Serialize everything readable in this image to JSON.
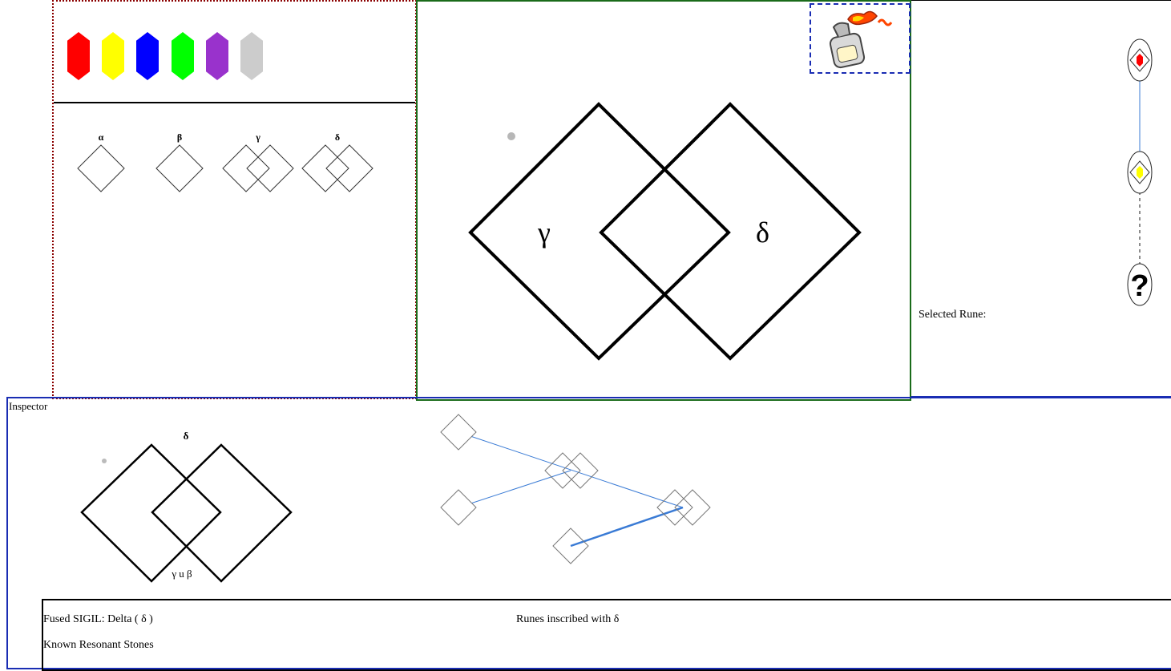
{
  "palette": {
    "gems": [
      {
        "name": "red",
        "color": "#ff0000"
      },
      {
        "name": "yellow",
        "color": "#ffff00"
      },
      {
        "name": "blue",
        "color": "#0000ff"
      },
      {
        "name": "green",
        "color": "#00ff00"
      },
      {
        "name": "purple",
        "color": "#9932cc"
      },
      {
        "name": "grey",
        "color": "#cccccc"
      }
    ],
    "sigils": [
      {
        "label": "α",
        "kind": "single"
      },
      {
        "label": "β",
        "kind": "single"
      },
      {
        "label": "γ",
        "kind": "double"
      },
      {
        "label": "δ",
        "kind": "double"
      }
    ]
  },
  "canvas": {
    "left_label": "γ",
    "right_label": "δ",
    "tool_icon": "torch-icon"
  },
  "timeline": {
    "nodes": [
      {
        "gem_color": "#ff0000",
        "link": "solid"
      },
      {
        "gem_color": "#ffff00",
        "link": "dashed"
      },
      {
        "symbol": "?",
        "icon": "unknown-icon"
      }
    ],
    "selected_rune_label": "Selected Rune:"
  },
  "inspector": {
    "title": "Inspector",
    "preview_top_label": "δ",
    "preview_bottom_label": "γ u β",
    "info": {
      "fused_sigil": "Fused SIGIL: Delta ( δ )",
      "runes_inscribed": "Runes inscribed with δ",
      "known_stones": "Known Resonant Stones"
    }
  },
  "colors": {
    "graph_edge": "#3a7bd5",
    "canvas_border": "#1a6b1a",
    "inspector_border": "#1a2db3",
    "palette_border": "#8b0000"
  }
}
